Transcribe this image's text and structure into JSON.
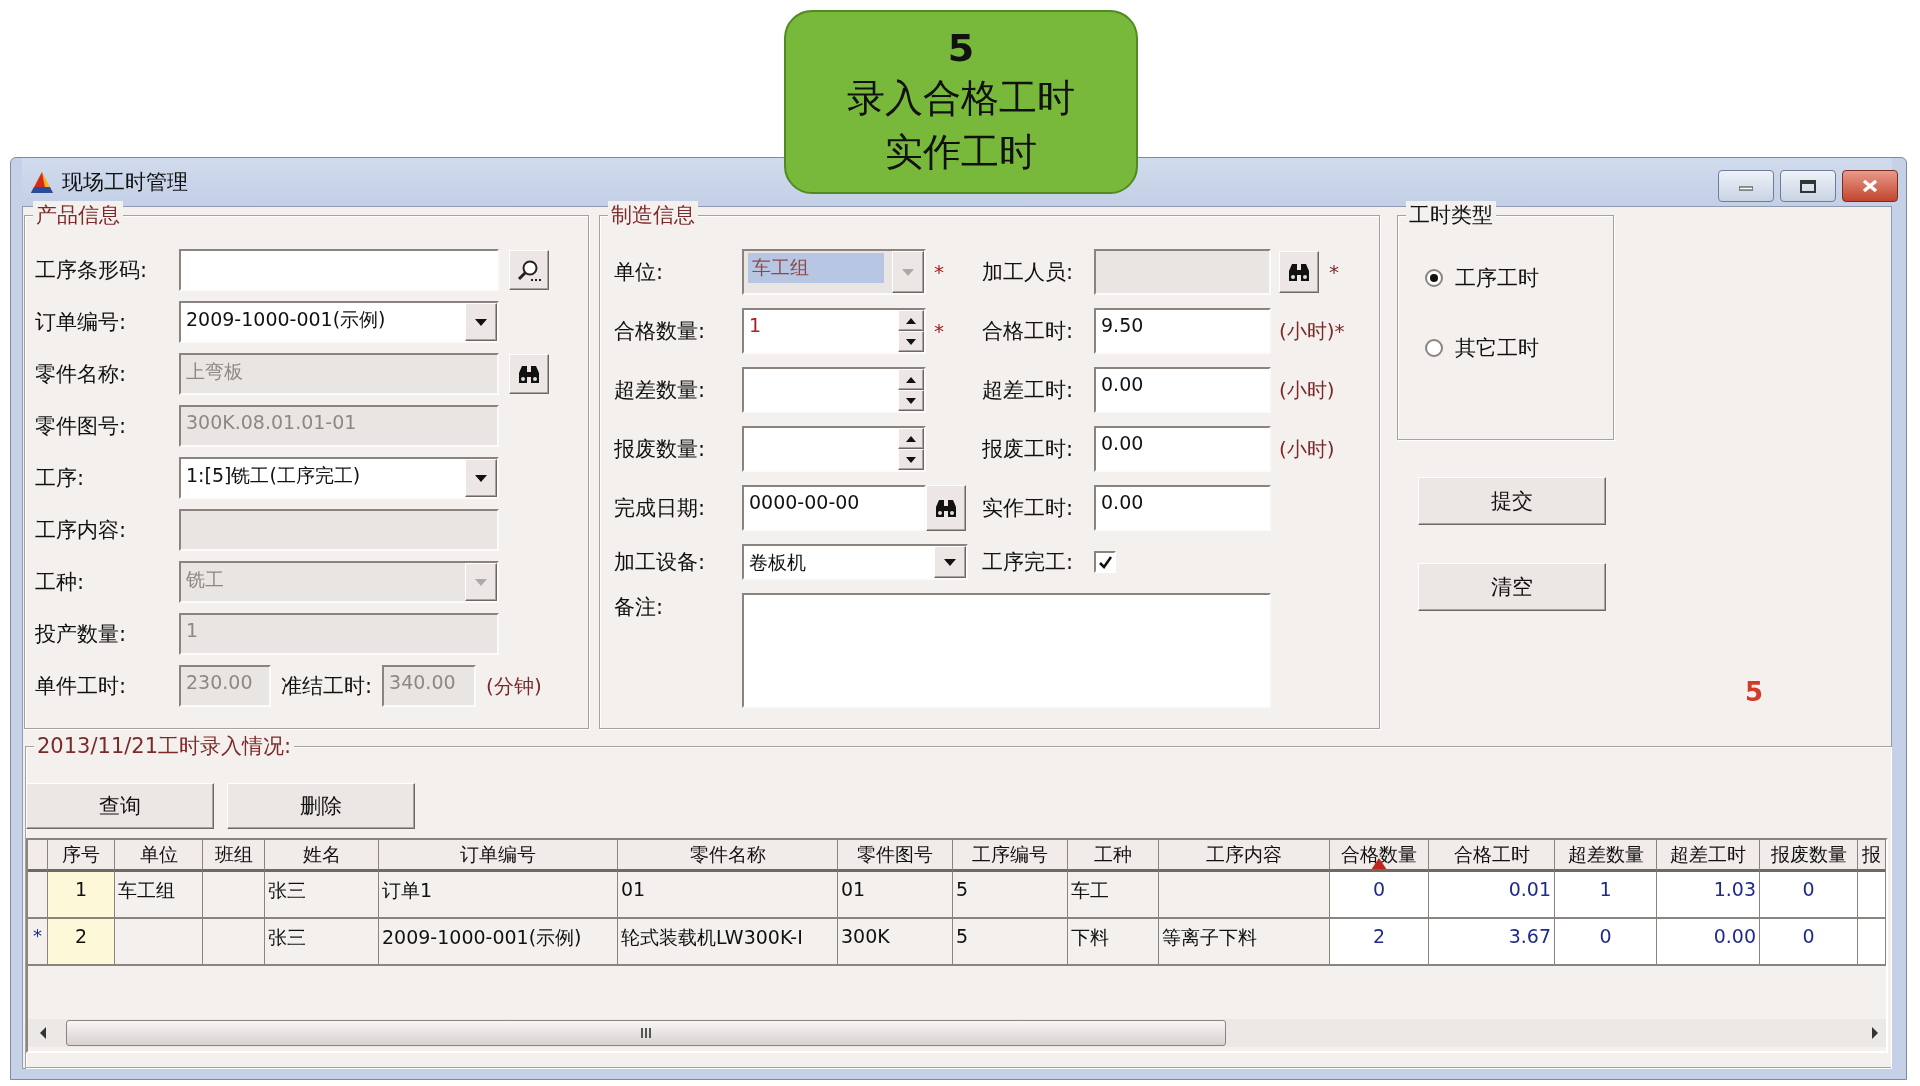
{
  "callout": {
    "number": "5",
    "lines": [
      "录入合格工时",
      "实作工时"
    ]
  },
  "window": {
    "title": "现场工时管理"
  },
  "product_info": {
    "title": "产品信息",
    "fields": [
      {
        "label": "工序条形码:",
        "kind": "text-search",
        "disabled": false
      },
      {
        "label": "订单编号:",
        "kind": "combo",
        "value": "2009-1000-001(示例)",
        "disabled": false
      },
      {
        "label": "零件名称:",
        "kind": "text-lookup",
        "value": "上弯板",
        "disabled": true
      },
      {
        "label": "零件图号:",
        "kind": "text",
        "value": "300K.08.01.01-01",
        "disabled": true
      },
      {
        "label": "工序:",
        "kind": "combo",
        "value": "1:[5]铣工(工序完工)",
        "disabled": false
      },
      {
        "label": "工序内容:",
        "kind": "text",
        "disabled": true
      },
      {
        "label": "工种:",
        "kind": "combo",
        "value": "铣工",
        "disabled": true
      },
      {
        "label": "投产数量:",
        "kind": "text",
        "value": "1",
        "disabled": true
      },
      {
        "label": "单件工时:",
        "kind": "pair",
        "value": "230.00",
        "disabled": true,
        "second": {
          "label": "准结工时:",
          "value": "340.00"
        },
        "suffix": "(分钟)"
      }
    ]
  },
  "manufacturing_info": {
    "title": "制造信息",
    "left_fields": [
      {
        "label": "单位:",
        "kind": "combo",
        "value": "车工组",
        "disabled": true,
        "highlighted": true,
        "mark": "*"
      },
      {
        "label": "合格数量:",
        "kind": "spin",
        "value": "1",
        "disabled": false,
        "highlighted": false,
        "mark": "*"
      },
      {
        "label": "超差数量:",
        "kind": "spin",
        "disabled": false,
        "highlighted": false
      },
      {
        "label": "报废数量:",
        "kind": "spin",
        "disabled": false,
        "highlighted": false
      },
      {
        "label": "完成日期:",
        "kind": "date-lookup",
        "value": "0000-00-00",
        "disabled": false,
        "highlighted": false
      },
      {
        "label": "加工设备:",
        "kind": "combo",
        "value": "卷板机",
        "disabled": false,
        "highlighted": false
      }
    ],
    "right_fields": [
      {
        "label": "加工人员:",
        "kind": "text-lookup",
        "disabled": true,
        "suffix": "*"
      },
      {
        "label": "合格工时:",
        "kind": "text",
        "value": "9.50",
        "disabled": false,
        "suffix": "(小时)*"
      },
      {
        "label": "超差工时:",
        "kind": "text",
        "value": "0.00",
        "disabled": false,
        "suffix": "(小时)"
      },
      {
        "label": "报废工时:",
        "kind": "text",
        "value": "0.00",
        "disabled": false,
        "suffix": "(小时)"
      },
      {
        "label": "实作工时:",
        "kind": "text",
        "value": "0.00",
        "disabled": false
      },
      {
        "label": "工序完工:",
        "kind": "checkbox",
        "checked": true
      }
    ],
    "remarks": {
      "label": "备注:"
    }
  },
  "hours_type": {
    "title": "工时类型",
    "options": [
      {
        "label": "工序工时",
        "selected": true
      },
      {
        "label": "其它工时",
        "selected": false
      }
    ]
  },
  "actions": [
    "提交",
    "清空"
  ],
  "step_marker": "5",
  "records": {
    "title": "2013/11/21工时录入情况:",
    "buttons": [
      "查询",
      "删除"
    ],
    "columns": [
      {
        "label": "序号",
        "kind": "index",
        "sorted": false
      },
      {
        "label": "单位",
        "kind": "text",
        "sorted": false
      },
      {
        "label": "班组",
        "kind": "text",
        "sorted": false
      },
      {
        "label": "姓名",
        "kind": "text",
        "sorted": false
      },
      {
        "label": "订单编号",
        "kind": "text",
        "sorted": false
      },
      {
        "label": "零件名称",
        "kind": "text",
        "sorted": false
      },
      {
        "label": "零件图号",
        "kind": "text",
        "sorted": false
      },
      {
        "label": "工序编号",
        "kind": "text",
        "sorted": false
      },
      {
        "label": "工种",
        "kind": "text",
        "sorted": false
      },
      {
        "label": "工序内容",
        "kind": "text",
        "sorted": false
      },
      {
        "label": "合格数量",
        "kind": "count",
        "sorted": true
      },
      {
        "label": "合格工时",
        "kind": "hours",
        "sorted": false
      },
      {
        "label": "超差数量",
        "kind": "count",
        "sorted": false
      },
      {
        "label": "超差工时",
        "kind": "hours",
        "sorted": false
      },
      {
        "label": "报废数量",
        "kind": "count",
        "sorted": false
      },
      {
        "label": "报",
        "kind": "count",
        "sorted": false
      }
    ],
    "rows": [
      {
        "cells": [
          "1",
          "车工组",
          null,
          "张三",
          "订单1",
          "01",
          "01",
          "5",
          "车工",
          null,
          "0",
          "0.01",
          "1",
          "1.03",
          "0",
          null
        ]
      },
      {
        "marker": "*",
        "cells": [
          "2",
          null,
          null,
          "张三",
          "2009-1000-001(示例)",
          "轮式装载机LW300K-I",
          "300K",
          "5",
          "下料",
          "等离子下料",
          "2",
          "3.67",
          "0",
          "0.00",
          "0",
          null
        ]
      }
    ]
  }
}
